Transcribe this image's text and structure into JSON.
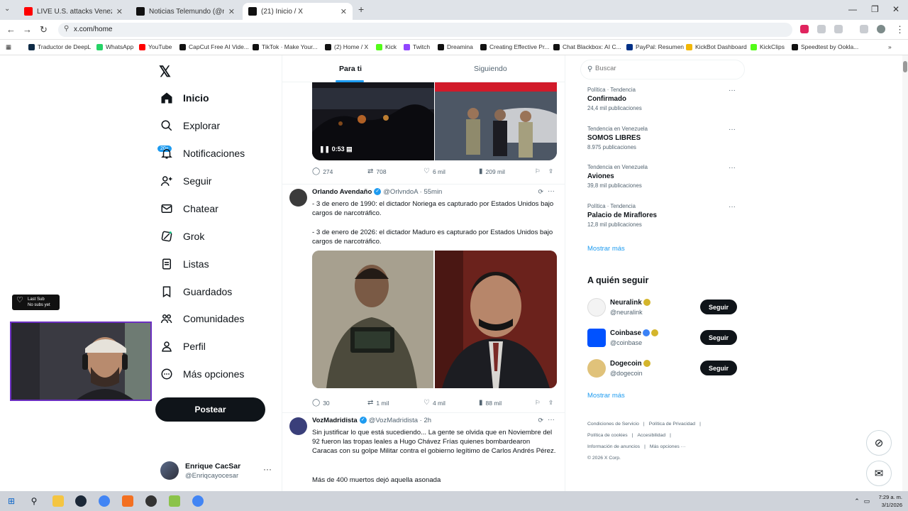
{
  "browser": {
    "tabs": [
      {
        "title": "LIVE U.S. attacks Venezuela, Tru",
        "favicon_color": "#ff0000"
      },
      {
        "title": "Noticias Telemundo (@noticias",
        "favicon_color": "#111111"
      },
      {
        "title": "(21) Inicio / X",
        "favicon_color": "#111111"
      }
    ],
    "url": "x.com/home",
    "bookmarks": [
      {
        "label": "Traductor de DeepL",
        "color": "#0f2b46"
      },
      {
        "label": "WhatsApp",
        "color": "#25d366"
      },
      {
        "label": "YouTube",
        "color": "#ff0000"
      },
      {
        "label": "CapCut Free AI Vide...",
        "color": "#111111"
      },
      {
        "label": "TikTok · Make Your...",
        "color": "#111111"
      },
      {
        "label": "(2) Home / X",
        "color": "#111111"
      },
      {
        "label": "Kick",
        "color": "#53fc18"
      },
      {
        "label": "Twitch",
        "color": "#9146ff"
      },
      {
        "label": "Dreamina",
        "color": "#111111"
      },
      {
        "label": "Creating Effective Pr...",
        "color": "#111111"
      },
      {
        "label": "Chat Blackbox: AI C...",
        "color": "#111111"
      },
      {
        "label": "PayPal: Resumen",
        "color": "#003087"
      },
      {
        "label": "KickBot Dashboard",
        "color": "#f2b705"
      },
      {
        "label": "KickClips",
        "color": "#53fc18"
      },
      {
        "label": "Speedtest by Ookla...",
        "color": "#111111"
      }
    ]
  },
  "nav": {
    "items": [
      {
        "label": "Inicio",
        "icon": "home-icon"
      },
      {
        "label": "Explorar",
        "icon": "search-icon"
      },
      {
        "label": "Notificaciones",
        "icon": "bell-icon"
      },
      {
        "label": "Seguir",
        "icon": "follow-icon"
      },
      {
        "label": "Chatear",
        "icon": "mail-icon"
      },
      {
        "label": "Grok",
        "icon": "grok-icon"
      },
      {
        "label": "Listas",
        "icon": "list-icon"
      },
      {
        "label": "Guardados",
        "icon": "bookmark-icon"
      },
      {
        "label": "Comunidades",
        "icon": "people-icon"
      },
      {
        "label": "Perfil",
        "icon": "user-icon"
      },
      {
        "label": "Más opciones",
        "icon": "more-icon"
      }
    ],
    "notif_badge": "20+",
    "post_label": "Postear",
    "account": {
      "name": "Enrique CacSar",
      "handle": "@Enriqcayocesar"
    }
  },
  "overlay": {
    "last_sub_title": "Last Sub",
    "last_sub_text": "No subs yet"
  },
  "feed": {
    "tabs": [
      "Para ti",
      "Siguiendo"
    ],
    "first_post": {
      "video_time": "0:53",
      "replies": "274",
      "reposts": "708",
      "likes": "6 mil",
      "views": "209 mil"
    },
    "tweets": [
      {
        "name": "Orlando Avendaño",
        "handle": "@OrlvndoA",
        "time": "· 55min",
        "text": [
          "- 3 de enero de 1990: el dictador Noriega es capturado por Estados Unidos bajo cargos de narcotráfico.",
          "- 3 de enero de 2026: el dictador Maduro es capturado por Estados Unidos bajo cargos de narcotráfico."
        ],
        "replies": "30",
        "reposts": "1 mil",
        "likes": "4 mil",
        "views": "88 mil"
      },
      {
        "name": "VozMadridista",
        "handle": "@VozMadridista",
        "time": "· 2h",
        "text": [
          "Sin justificar lo que está sucediendo... La gente se olvida que en Noviembre del 92 fueron las tropas leales a Hugo Chávez Frías quienes bombardearon Caracas con su golpe Militar contra el gobierno legítimo de Carlos Andrés Pérez.",
          "Más de 400 muertos dejó aquella asonada"
        ]
      }
    ]
  },
  "sidebar": {
    "search_placeholder": "Buscar",
    "trends": [
      {
        "category": "Política · Tendencia",
        "name": "Confirmado",
        "count": "24,4 mil publicaciones"
      },
      {
        "category": "Tendencia en Venezuela",
        "name": "SOMOS LIBRES",
        "count": "8.975 publicaciones"
      },
      {
        "category": "Tendencia en Venezuela",
        "name": "Aviones",
        "count": "39,8 mil publicaciones"
      },
      {
        "category": "Política · Tendencia",
        "name": "Palacio de Miraflores",
        "count": "12,8 mil publicaciones"
      }
    ],
    "show_more": "Mostrar más",
    "who_to_follow_title": "A quién seguir",
    "follow": [
      {
        "name": "Neuralink",
        "handle": "@neuralink",
        "button": "Seguir"
      },
      {
        "name": "Coinbase",
        "handle": "@coinbase",
        "button": "Seguir"
      },
      {
        "name": "Dogecoin",
        "handle": "@dogecoin",
        "button": "Seguir"
      }
    ],
    "show_more_2": "Mostrar más",
    "footer": [
      "Condiciones de Servicio",
      "|",
      "Política de Privacidad",
      "|",
      "Política de cookies",
      "|",
      "Accesibilidad",
      "|",
      "Información de anuncios",
      "|",
      "Más opciones ···",
      "© 2026 X Corp."
    ]
  },
  "taskbar": {
    "time": "7:29 a. m.",
    "date": "3/1/2026"
  }
}
